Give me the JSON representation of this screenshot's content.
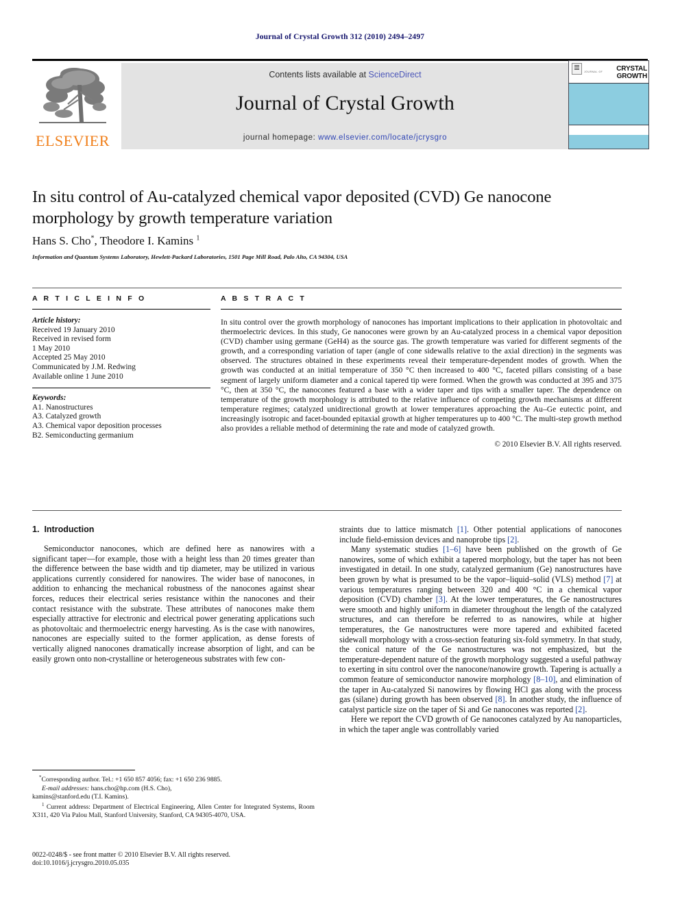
{
  "running_head": "Journal of Crystal Growth 312 (2010) 2494–2497",
  "masthead": {
    "publisher": "ELSEVIER",
    "contents_prefix": "Contents lists available at ",
    "contents_link": "ScienceDirect",
    "journal_name": "Journal of Crystal Growth",
    "homepage_prefix": "journal homepage: ",
    "homepage_url": "www.elsevier.com/locate/jcrysgro",
    "cover": {
      "journal_of": "JOURNAL OF",
      "title_line1": "CRYSTAL",
      "title_line2": "GROWTH",
      "band_color": "#8ccde0"
    }
  },
  "article": {
    "title": "In situ control of Au-catalyzed chemical vapor deposited (CVD) Ge nanocone morphology by growth temperature variation",
    "authors_part1": "Hans S. Cho",
    "authors_star": "*",
    "authors_part2": ", Theodore I. Kamins ",
    "authors_sup": "1",
    "affiliation": "Information and Quantum Systems Laboratory, Hewlett-Packard Laboratories, 1501 Page Mill Road, Palo Alto, CA 94304, USA"
  },
  "article_info": {
    "heading": "A R T I C L E   I N F O",
    "history_label": "Article history:",
    "history": [
      "Received 19 January 2010",
      "Received in revised form",
      "1 May 2010",
      "Accepted 25 May 2010",
      "Communicated by J.M. Redwing",
      "Available online 1 June 2010"
    ],
    "keywords_label": "Keywords:",
    "keywords": [
      "A1. Nanostructures",
      "A3. Catalyzed growth",
      "A3. Chemical vapor deposition processes",
      "B2. Semiconducting germanium"
    ]
  },
  "abstract": {
    "heading": "A B S T R A C T",
    "text": "In situ control over the growth morphology of nanocones has important implications to their application in photovoltaic and thermoelectric devices. In this study, Ge nanocones were grown by an Au-catalyzed process in a chemical vapor deposition (CVD) chamber using germane (GeH4) as the source gas. The growth temperature was varied for different segments of the growth, and a corresponding variation of taper (angle of cone sidewalls relative to the axial direction) in the segments was observed. The structures obtained in these experiments reveal their temperature-dependent modes of growth. When the growth was conducted at an initial temperature of 350 °C then increased to 400 °C, faceted pillars consisting of a base segment of largely uniform diameter and a conical tapered tip were formed. When the growth was conducted at 395 and 375 °C, then at 350 °C, the nanocones featured a base with a wider taper and tips with a smaller taper. The dependence on temperature of the growth morphology is attributed to the relative influence of competing growth mechanisms at different temperature regimes; catalyzed unidirectional growth at lower temperatures approaching the Au–Ge eutectic point, and increasingly isotropic and facet-bounded epitaxial growth at higher temperatures up to 400 °C. The multi-step growth method also provides a reliable method of determining the rate and mode of catalyzed growth.",
    "copyright": "© 2010 Elsevier B.V. All rights reserved."
  },
  "body": {
    "section1_number": "1.",
    "section1_title": "Introduction",
    "left_para1": "Semiconductor nanocones, which are defined here as nanowires with a significant taper—for example, those with a height less than 20 times greater than the difference between the base width and tip diameter, may be utilized in various applications currently considered for nanowires. The wider base of nanocones, in addition to enhancing the mechanical robustness of the nanocones against shear forces, reduces their electrical series resistance within the nanocones and their contact resistance with the substrate. These attributes of nanocones make them especially attractive for electronic and electrical power generating applications such as photovoltaic and thermoelectric energy harvesting. As is the case with nanowires, nanocones are especially suited to the former application, as dense forests of vertically aligned nanocones dramatically increase absorption of light, and can be easily grown onto non-crystalline or heterogeneous substrates with few con-",
    "right_para1_a": "straints due to lattice mismatch ",
    "right_para1_cite1": "[1]",
    "right_para1_b": ". Other potential applications of nanocones include field-emission devices and nanoprobe tips ",
    "right_para1_cite2": "[2]",
    "right_para1_c": ".",
    "right_para2_a": "Many systematic studies ",
    "right_para2_cite1": "[1–6]",
    "right_para2_b": " have been published on the growth of Ge nanowires, some of which exhibit a tapered morphology, but the taper has not been investigated in detail. In one study, catalyzed germanium (Ge) nanostructures have been grown by what is presumed to be the vapor–liquid–solid (VLS) method ",
    "right_para2_cite2": "[7]",
    "right_para2_c": " at various temperatures ranging between 320 and 400 °C in a chemical vapor deposition (CVD) chamber ",
    "right_para2_cite3": "[3]",
    "right_para2_d": ". At the lower temperatures, the Ge nanostructures were smooth and highly uniform in diameter throughout the length of the catalyzed structures, and can therefore be referred to as nanowires, while at higher temperatures, the Ge nanostructures were more tapered and exhibited faceted sidewall morphology with a cross-section featuring six-fold symmetry. In that study, the conical nature of the Ge nanostructures was not emphasized, but the temperature-dependent nature of the growth morphology suggested a useful pathway to exerting in situ control over the nanocone/nanowire growth. Tapering is actually a common feature of semiconductor nanowire morphology ",
    "right_para2_cite4": "[8–10]",
    "right_para2_e": ", and elimination of the taper in Au-catalyzed Si nanowires by flowing HCl gas along with the process gas (silane) during growth has been observed ",
    "right_para2_cite5": "[8]",
    "right_para2_f": ". In another study, the influence of catalyst particle size on the taper of Si and Ge nanocones was reported ",
    "right_para2_cite6": "[2]",
    "right_para2_g": ".",
    "right_para3": "Here we report the CVD growth of Ge nanocones catalyzed by Au nanoparticles, in which the taper angle was controllably varied"
  },
  "footnotes": {
    "corresponding_star": "*",
    "corresponding": "Corresponding author. Tel.: +1 650 857 4056; fax: +1 650 236 9885.",
    "email_label": "E-mail addresses:",
    "email_text": " hans.cho@hp.com (H.S. Cho),",
    "email_text2": "kamins@stanford.edu (T.I. Kamins).",
    "current_address_sup": "1",
    "current_address": " Current address: Department of Electrical Engineering, Allen Center for Integrated Systems, Room X311, 420 Via Palou Mall, Stanford University, Stanford, CA 94305-4070, USA.",
    "issn_line": "0022-0248/$ - see front matter © 2010 Elsevier B.V. All rights reserved.",
    "doi_line": "doi:10.1016/j.jcrysgro.2010.05.035"
  }
}
